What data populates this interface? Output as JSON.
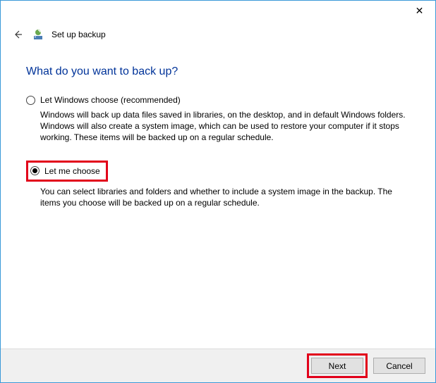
{
  "window": {
    "close_glyph": "✕"
  },
  "header": {
    "back_glyph": "←",
    "title": "Set up backup"
  },
  "main": {
    "heading": "What do you want to back up?",
    "options": [
      {
        "label": "Let Windows choose (recommended)",
        "desc": "Windows will back up data files saved in libraries, on the desktop, and in default Windows folders. Windows will also create a system image, which can be used to restore your computer if it stops working. These items will be backed up on a regular schedule.",
        "checked": false
      },
      {
        "label": "Let me choose",
        "desc": "You can select libraries and folders and whether to include a system image in the backup. The items you choose will be backed up on a regular schedule.",
        "checked": true
      }
    ]
  },
  "footer": {
    "next": "Next",
    "cancel": "Cancel"
  }
}
